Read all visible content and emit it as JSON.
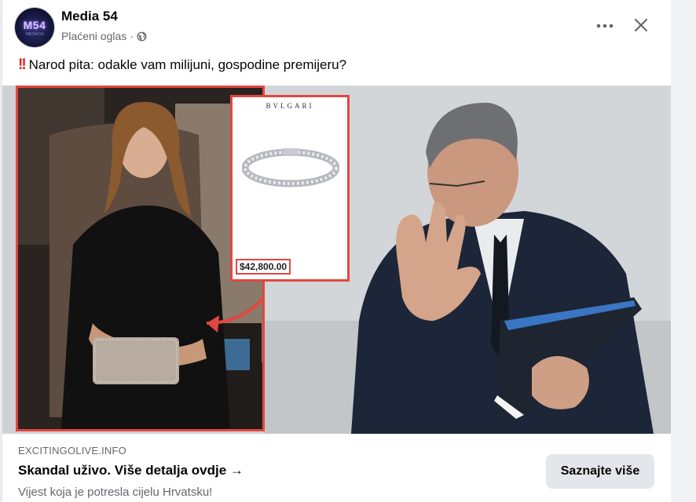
{
  "header": {
    "avatar_text": "M54",
    "avatar_subtext": "MEDIA 54",
    "page_name": "Media 54",
    "sponsored_label": "Plaćeni oglas",
    "separator": "·"
  },
  "post": {
    "emoji": "‼️",
    "text": "Narod pita: odakle vam milijuni, gospodine premijeru?"
  },
  "ad_image": {
    "product_brand": "BVLGARI",
    "product_price": "$42,800.00",
    "accent_color": "#e2473f"
  },
  "link": {
    "domain": "EXCITINGOLIVE.INFO",
    "title": "Skandal uživo. Više detalja ovdje →",
    "description": "Vijest koja je potresla cijelu Hrvatsku!",
    "cta_label": "Saznajte više"
  },
  "icons": {
    "more": "more-horizontal-icon",
    "close": "close-icon",
    "audience": "globe-icon"
  }
}
